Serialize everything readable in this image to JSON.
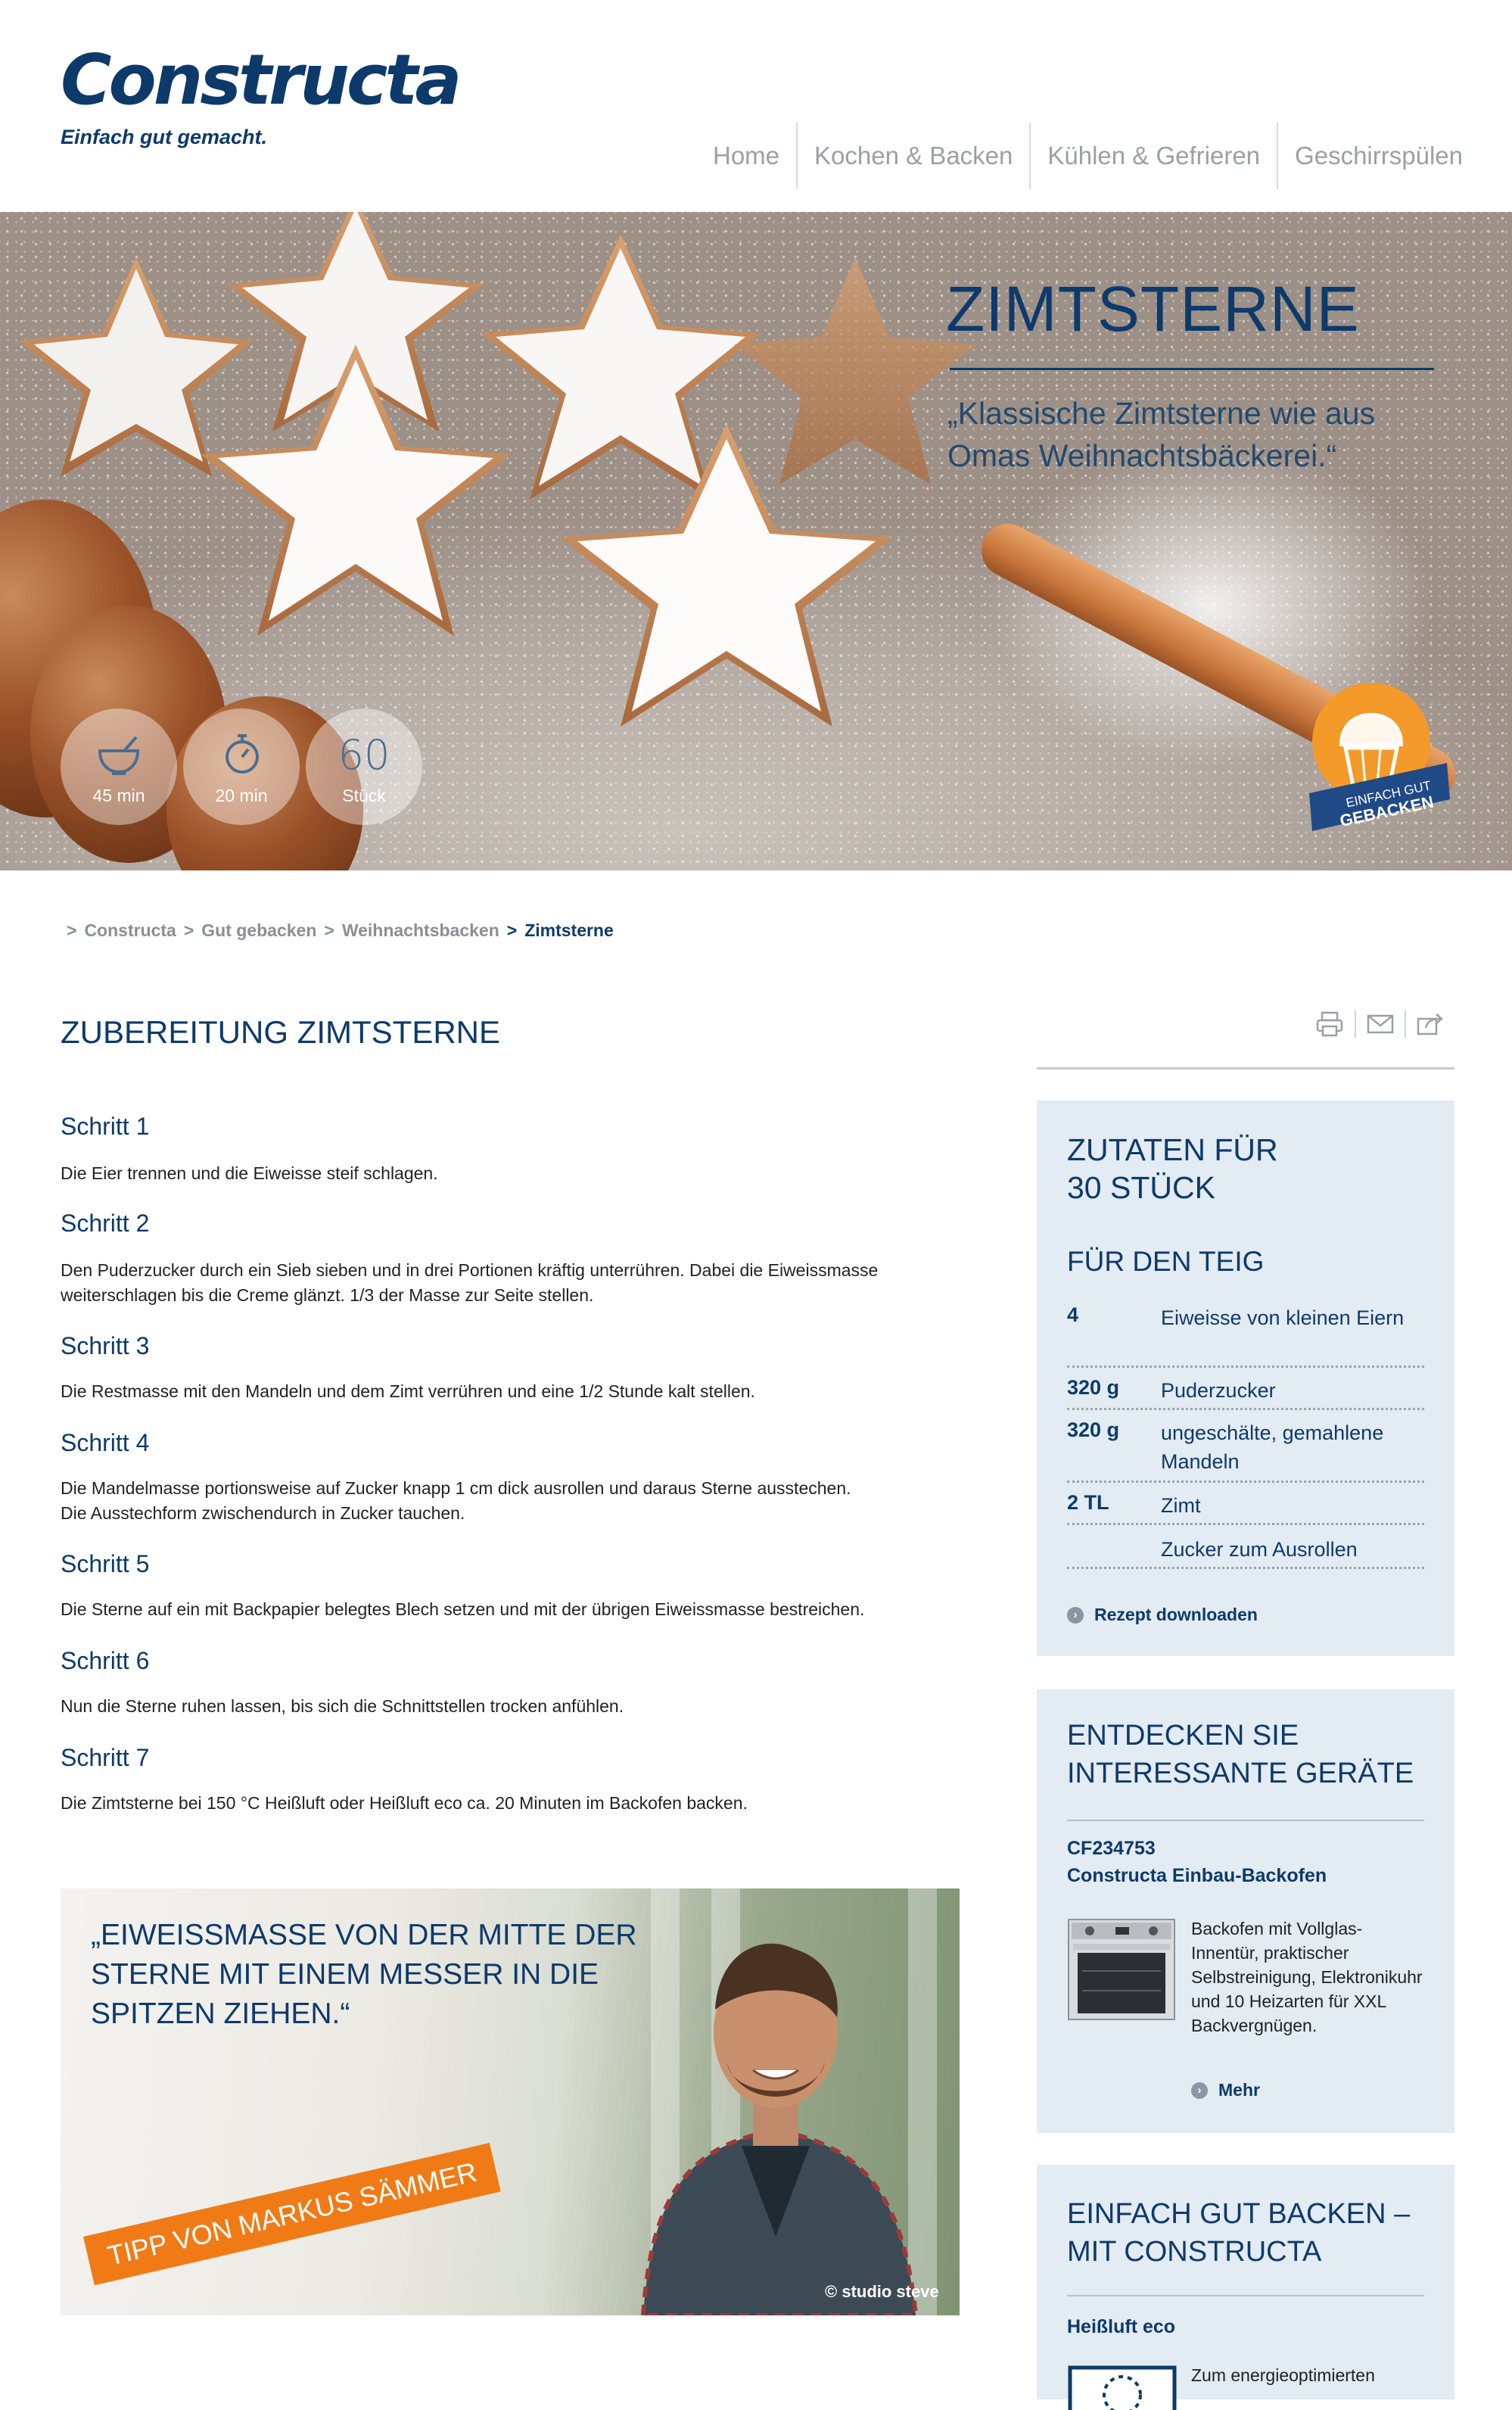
{
  "brand": {
    "name": "Constructa",
    "tagline": "Einfach gut gemacht."
  },
  "nav": [
    "Home",
    "Kochen & Backen",
    "Kühlen & Gefrieren",
    "Geschirrspülen"
  ],
  "hero": {
    "title": "ZIMTSTERNE",
    "quote": "„Klassische Zimtsterne wie aus Omas Weihnachtsbäckerei.“",
    "stats": [
      {
        "icon": "mixing-bowl-icon",
        "value": "45 min"
      },
      {
        "icon": "stopwatch-icon",
        "value": "20 min"
      },
      {
        "big": "60",
        "value": "Stück"
      }
    ],
    "badge": {
      "line1": "EINFACH GUT",
      "line2": "GEBACKEN"
    }
  },
  "breadcrumb": [
    "Constructa",
    "Gut gebacken",
    "Weihnachtsbacken",
    "Zimtsterne"
  ],
  "main": {
    "title": "ZUBEREITUNG ZIMTSTERNE",
    "steps": [
      {
        "title": "Schritt 1",
        "lines": [
          "Die Eier trennen und die Eiweisse steif schlagen."
        ]
      },
      {
        "title": "Schritt 2",
        "lines": [
          "Den Puderzucker durch ein Sieb sieben und in drei Portionen kräftig unterrühren. Dabei die Eiweissmasse",
          "weiterschlagen bis die Creme glänzt. 1/3 der Masse zur Seite stellen."
        ]
      },
      {
        "title": "Schritt 3",
        "lines": [
          "Die Restmasse mit den Mandeln und dem Zimt verrühren und eine 1/2 Stunde kalt stellen."
        ]
      },
      {
        "title": "Schritt 4",
        "lines": [
          "Die Mandelmasse portionsweise auf Zucker knapp 1 cm dick ausrollen und daraus Sterne ausstechen.",
          "Die Ausstechform zwischendurch in Zucker tauchen."
        ]
      },
      {
        "title": "Schritt 5",
        "lines": [
          "Die Sterne auf ein mit Backpapier belegtes Blech setzen und mit der übrigen Eiweissmasse bestreichen."
        ]
      },
      {
        "title": "Schritt 6",
        "lines": [
          "Nun die Sterne ruhen lassen, bis sich die Schnittstellen trocken anfühlen."
        ]
      },
      {
        "title": "Schritt 7",
        "lines": [
          "Die Zimtsterne bei 150 °C Heißluft oder Heißluft eco ca. 20 Minuten im Backofen backen."
        ]
      }
    ]
  },
  "tip": {
    "quote": "„EIWEISSMASSE VON DER MITTE DER STERNE MIT EINEM MESSER IN DIE SPITZEN ZIEHEN.“",
    "banner": "TIPP VON MARKUS SÄMMER",
    "credit": "© studio steve"
  },
  "ingredients": {
    "title_line1": "ZUTATEN FÜR",
    "title_line2": "30 STÜCK",
    "section": "FÜR DEN TEIG",
    "items": [
      {
        "amount": "4",
        "name": "Eiweisse von kleinen Eiern"
      },
      {
        "amount": "320 g",
        "name": "Puderzucker"
      },
      {
        "amount": "320 g",
        "name": "ungeschälte, gemahlene Mandeln"
      },
      {
        "amount": "2 TL",
        "name": "Zimt"
      },
      {
        "amount": "",
        "name": "Zucker zum Ausrollen"
      }
    ],
    "download": "Rezept downloaden"
  },
  "devices": {
    "title_line1": "ENTDECKEN SIE",
    "title_line2": "INTERESSANTE GERÄTE",
    "model": "CF234753",
    "product": "Constructa Einbau-Backofen",
    "desc": "Backofen mit Vollglas-Innentür, praktischer Selbstreinigung, Elektronikuhr und 10 Heizarten für XXL Backvergnügen.",
    "more": "Mehr"
  },
  "baking": {
    "title_line1": "EINFACH GUT BACKEN –",
    "title_line2": "MIT CONSTRUCTA",
    "feature": "Heißluft eco",
    "desc": "Zum energieoptimierten"
  },
  "colors": {
    "brand": "#0d3a6b",
    "accent": "#f07b16",
    "card": "#e3ebf3"
  }
}
